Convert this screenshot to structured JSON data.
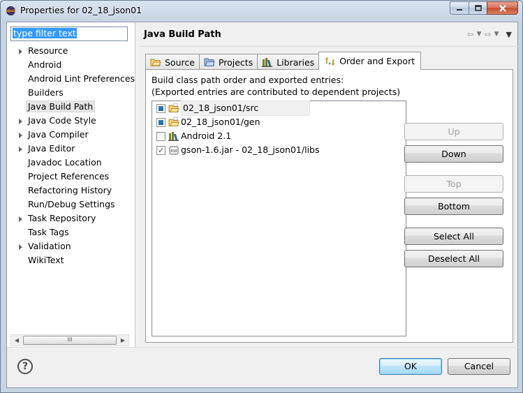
{
  "window": {
    "title": "Properties for 02_18_json01",
    "icon": "eclipse-icon"
  },
  "sidebar": {
    "filter_text": "type filter text",
    "items": [
      {
        "label": "Resource",
        "expandable": true
      },
      {
        "label": "Android",
        "expandable": false
      },
      {
        "label": "Android Lint Preferences",
        "expandable": false
      },
      {
        "label": "Builders",
        "expandable": false
      },
      {
        "label": "Java Build Path",
        "expandable": false,
        "selected": true
      },
      {
        "label": "Java Code Style",
        "expandable": true
      },
      {
        "label": "Java Compiler",
        "expandable": true
      },
      {
        "label": "Java Editor",
        "expandable": true
      },
      {
        "label": "Javadoc Location",
        "expandable": false
      },
      {
        "label": "Project References",
        "expandable": false
      },
      {
        "label": "Refactoring History",
        "expandable": false
      },
      {
        "label": "Run/Debug Settings",
        "expandable": false
      },
      {
        "label": "Task Repository",
        "expandable": true
      },
      {
        "label": "Task Tags",
        "expandable": false
      },
      {
        "label": "Validation",
        "expandable": true
      },
      {
        "label": "WikiText",
        "expandable": false
      }
    ],
    "scroll_thumb_label": "III"
  },
  "page": {
    "title": "Java Build Path",
    "tabs": [
      {
        "label": "Source",
        "icon": "source-folder-icon"
      },
      {
        "label": "Projects",
        "icon": "project-folder-icon"
      },
      {
        "label": "Libraries",
        "icon": "library-icon"
      },
      {
        "label": "Order and Export",
        "icon": "order-export-icon",
        "active": true
      }
    ],
    "description_line1": "Build class path order and exported entries:",
    "description_line2": "(Exported entries are contributed to dependent projects)",
    "entries": [
      {
        "label": "02_18_json01/src",
        "check": "partial",
        "icon": "source-folder-icon"
      },
      {
        "label": "02_18_json01/gen",
        "check": "partial",
        "icon": "source-folder-icon"
      },
      {
        "label": "Android 2.1",
        "check": "unchecked",
        "icon": "library-icon"
      },
      {
        "label": "gson-1.6.jar - 02_18_json01/libs",
        "check": "checked",
        "icon": "jar-icon"
      }
    ],
    "buttons": {
      "up": "Up",
      "down": "Down",
      "top": "Top",
      "bottom": "Bottom",
      "select_all": "Select All",
      "deselect_all": "Deselect All"
    }
  },
  "footer": {
    "ok": "OK",
    "cancel": "Cancel"
  },
  "colors": {
    "selection": "#3399ff",
    "check_fill": "#2c7fb8",
    "disabled_text": "#a0a0a0"
  }
}
